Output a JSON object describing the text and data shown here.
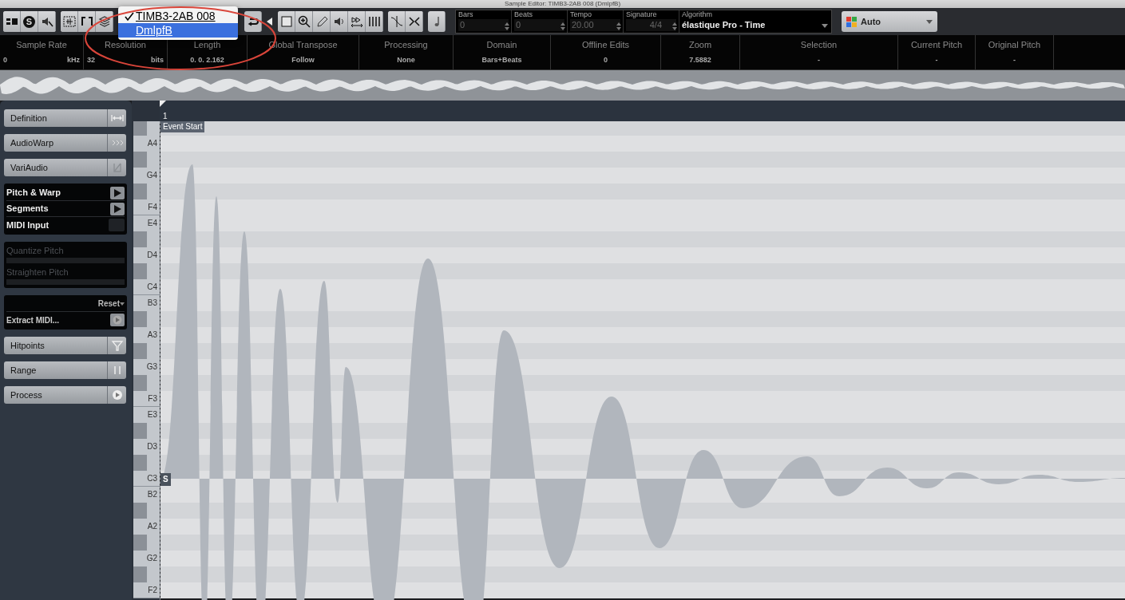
{
  "window": {
    "title": "Sample Editor: TIMB3-2AB 008 (DmlpfB)"
  },
  "solo_button": {
    "label": "S"
  },
  "event_menu": [
    {
      "label": "TIMB3-2AB 008",
      "checked": true,
      "selected": false
    },
    {
      "label": "DmlpfB",
      "checked": false,
      "selected": true
    }
  ],
  "fields": [
    {
      "label": "Bars",
      "value": "0"
    },
    {
      "label": "Beats",
      "value": "0"
    },
    {
      "label": "Tempo",
      "value": "20.00"
    },
    {
      "label": "Signature",
      "value": "4/4"
    }
  ],
  "algorithm": {
    "label": "Algorithm",
    "value": "élastique Pro - Time"
  },
  "color_menu": {
    "value": "Auto"
  },
  "info_line": [
    {
      "label": "Sample Rate",
      "value": "0",
      "unit": "kHz"
    },
    {
      "label": "Resolution",
      "value": "32",
      "unit": "bits"
    },
    {
      "label": "Length",
      "value": "0. 0. 2.162"
    },
    {
      "label": "Global Transpose",
      "value": "Follow"
    },
    {
      "label": "Processing",
      "value": "None"
    },
    {
      "label": "Domain",
      "value": "Bars+Beats"
    },
    {
      "label": "Offline Edits",
      "value": "0"
    },
    {
      "label": "Zoom",
      "value": "7.5882"
    },
    {
      "label": "Selection",
      "value": "-"
    },
    {
      "label": "Current Pitch",
      "value": "-"
    },
    {
      "label": "Original Pitch",
      "value": "-"
    }
  ],
  "inspector": {
    "top_sections": [
      "Definition",
      "AudioWarp",
      "VariAudio"
    ],
    "variaudio_rows": [
      {
        "label": "Pitch & Warp",
        "kind": "tool"
      },
      {
        "label": "Segments",
        "kind": "tool"
      },
      {
        "label": "MIDI Input",
        "kind": "toggle",
        "on": false
      }
    ],
    "sliders": [
      {
        "label": "Quantize Pitch",
        "disabled": true
      },
      {
        "label": "Straighten Pitch",
        "disabled": true
      }
    ],
    "reset": "Reset",
    "extract": "Extract MIDI...",
    "bottom_sections": [
      "Hitpoints",
      "Range",
      "Process"
    ]
  },
  "ruler": {
    "bar": "1",
    "event_start": "Event Start",
    "start_marker": "S"
  },
  "keys": [
    {
      "kind": "black"
    },
    {
      "kind": "white",
      "label": "A4"
    },
    {
      "kind": "black"
    },
    {
      "kind": "white",
      "label": "G4"
    },
    {
      "kind": "black"
    },
    {
      "kind": "white",
      "label": "F4"
    },
    {
      "kind": "white",
      "label": "E4"
    },
    {
      "kind": "black"
    },
    {
      "kind": "white",
      "label": "D4"
    },
    {
      "kind": "black"
    },
    {
      "kind": "white",
      "label": "C4"
    },
    {
      "kind": "white",
      "label": "B3"
    },
    {
      "kind": "black"
    },
    {
      "kind": "white",
      "label": "A3"
    },
    {
      "kind": "black"
    },
    {
      "kind": "white",
      "label": "G3"
    },
    {
      "kind": "black"
    },
    {
      "kind": "white",
      "label": "F3"
    },
    {
      "kind": "white",
      "label": "E3"
    },
    {
      "kind": "black"
    },
    {
      "kind": "white",
      "label": "D3"
    },
    {
      "kind": "black"
    },
    {
      "kind": "white",
      "label": "C3"
    },
    {
      "kind": "white",
      "label": "B2"
    },
    {
      "kind": "black"
    },
    {
      "kind": "white",
      "label": "A2"
    },
    {
      "kind": "black"
    },
    {
      "kind": "white",
      "label": "G2"
    },
    {
      "kind": "black"
    },
    {
      "kind": "white",
      "label": "F2"
    }
  ]
}
